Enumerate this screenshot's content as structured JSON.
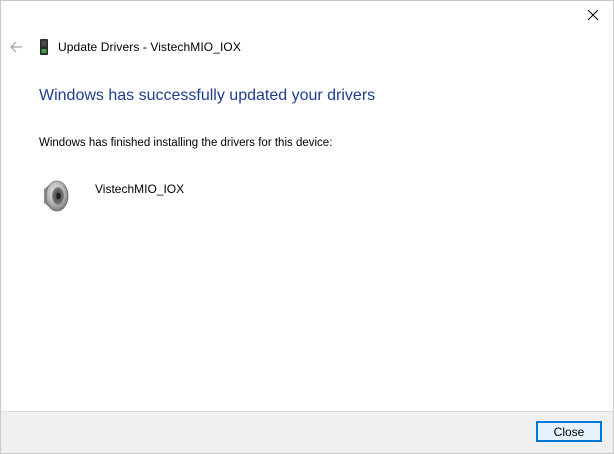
{
  "window": {
    "title": "Update Drivers - VistechMIO_IOX"
  },
  "heading": "Windows has successfully updated your drivers",
  "message": "Windows has finished installing the drivers for this device:",
  "device": {
    "name": "VistechMIO_IOX",
    "icon": "speaker-icon"
  },
  "footer": {
    "close_label": "Close"
  },
  "colors": {
    "heading": "#1e3d8f",
    "footer_bg": "#f0f0f0",
    "button_border": "#0078d7",
    "button_bg": "#e5f1fb"
  }
}
